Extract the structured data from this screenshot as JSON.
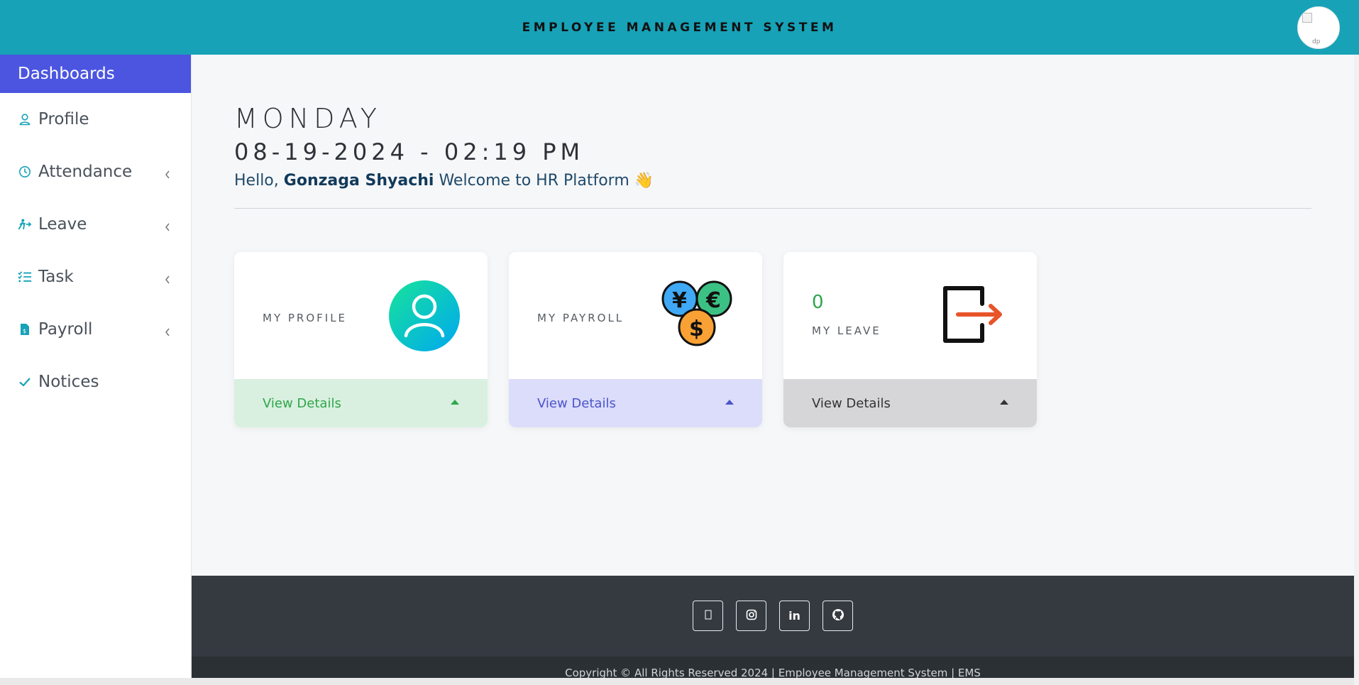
{
  "header": {
    "title": "EMPLOYEE MANAGEMENT SYSTEM",
    "avatar_alt": "dp"
  },
  "sidebar": {
    "title": "Dashboards",
    "items": [
      {
        "label": "Profile",
        "icon": "user-icon",
        "has_submenu": false
      },
      {
        "label": "Attendance",
        "icon": "clock-icon",
        "has_submenu": true
      },
      {
        "label": "Leave",
        "icon": "walking-icon",
        "has_submenu": true
      },
      {
        "label": "Task",
        "icon": "task-list-icon",
        "has_submenu": true
      },
      {
        "label": "Payroll",
        "icon": "invoice-icon",
        "has_submenu": true
      },
      {
        "label": "Notices",
        "icon": "check-icon",
        "has_submenu": false
      }
    ]
  },
  "main": {
    "day": "MONDAY",
    "datetime": "08-19-2024 - 02:19 PM",
    "greeting_prefix": "Hello,",
    "user_name": "Gonzaga Shyachi",
    "greeting_suffix": "Welcome to HR Platform",
    "greeting_emoji": "👋"
  },
  "cards": [
    {
      "label": "MY PROFILE",
      "link": "View Details",
      "icon": "profile-avatar-icon",
      "color": "#2fa64a"
    },
    {
      "label": "MY PAYROLL",
      "link": "View Details",
      "icon": "currency-coins-icon",
      "color": "#4b55c8"
    },
    {
      "label": "MY LEAVE",
      "count": "0",
      "link": "View Details",
      "icon": "exit-door-icon",
      "color": "#333333"
    }
  ],
  "footer": {
    "social": [
      "facebook-icon",
      "instagram-icon",
      "linkedin-icon",
      "github-icon"
    ],
    "linkedin_label": "in",
    "copyright": "Copyright © All Rights Reserved 2024 | Employee Management System | EMS"
  },
  "colors": {
    "topbar": "#17a2b8",
    "sidebar_active": "#4b55e0",
    "footer": "#343a40"
  }
}
